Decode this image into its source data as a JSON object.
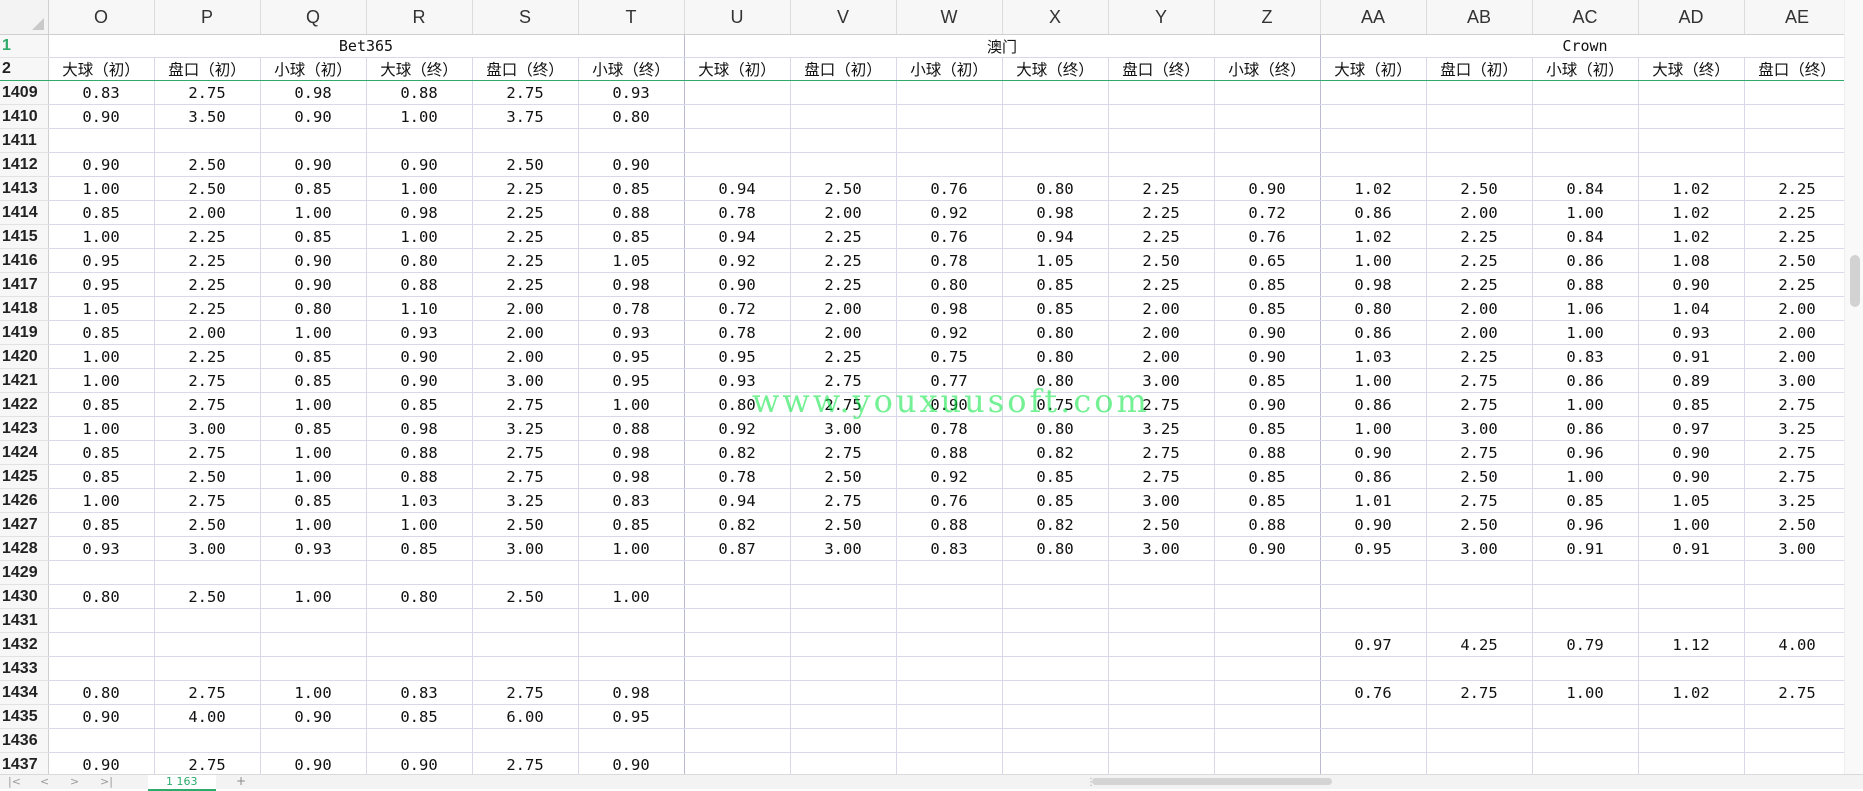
{
  "columns": [
    "O",
    "P",
    "Q",
    "R",
    "S",
    "T",
    "U",
    "V",
    "W",
    "X",
    "Y",
    "Z",
    "AA",
    "AB",
    "AC",
    "AD",
    "AE"
  ],
  "groups": [
    {
      "label": "Bet365",
      "span": 6
    },
    {
      "label": "澳门",
      "span": 6
    },
    {
      "label": "Crown",
      "span": 5
    }
  ],
  "subheaders": [
    "大球（初）",
    "盘口（初）",
    "小球（初）",
    "大球（终）",
    "盘口（终）",
    "小球（终）",
    "大球（初）",
    "盘口（初）",
    "小球（初）",
    "大球（终）",
    "盘口（终）",
    "小球（终）",
    "大球（初）",
    "盘口（初）",
    "小球（初）",
    "大球（终）",
    "盘口（终）"
  ],
  "header_rows": [
    "1",
    "2"
  ],
  "rows": [
    {
      "n": "1409",
      "v": [
        "0.83",
        "2.75",
        "0.98",
        "0.88",
        "2.75",
        "0.93",
        "",
        "",
        "",
        "",
        "",
        "",
        "",
        "",
        "",
        "",
        ""
      ]
    },
    {
      "n": "1410",
      "v": [
        "0.90",
        "3.50",
        "0.90",
        "1.00",
        "3.75",
        "0.80",
        "",
        "",
        "",
        "",
        "",
        "",
        "",
        "",
        "",
        "",
        ""
      ]
    },
    {
      "n": "1411",
      "v": [
        "",
        "",
        "",
        "",
        "",
        "",
        "",
        "",
        "",
        "",
        "",
        "",
        "",
        "",
        "",
        "",
        ""
      ]
    },
    {
      "n": "1412",
      "v": [
        "0.90",
        "2.50",
        "0.90",
        "0.90",
        "2.50",
        "0.90",
        "",
        "",
        "",
        "",
        "",
        "",
        "",
        "",
        "",
        "",
        ""
      ]
    },
    {
      "n": "1413",
      "v": [
        "1.00",
        "2.50",
        "0.85",
        "1.00",
        "2.25",
        "0.85",
        "0.94",
        "2.50",
        "0.76",
        "0.80",
        "2.25",
        "0.90",
        "1.02",
        "2.50",
        "0.84",
        "1.02",
        "2.25"
      ]
    },
    {
      "n": "1414",
      "v": [
        "0.85",
        "2.00",
        "1.00",
        "0.98",
        "2.25",
        "0.88",
        "0.78",
        "2.00",
        "0.92",
        "0.98",
        "2.25",
        "0.72",
        "0.86",
        "2.00",
        "1.00",
        "1.02",
        "2.25"
      ]
    },
    {
      "n": "1415",
      "v": [
        "1.00",
        "2.25",
        "0.85",
        "1.00",
        "2.25",
        "0.85",
        "0.94",
        "2.25",
        "0.76",
        "0.94",
        "2.25",
        "0.76",
        "1.02",
        "2.25",
        "0.84",
        "1.02",
        "2.25"
      ]
    },
    {
      "n": "1416",
      "v": [
        "0.95",
        "2.25",
        "0.90",
        "0.80",
        "2.25",
        "1.05",
        "0.92",
        "2.25",
        "0.78",
        "1.05",
        "2.50",
        "0.65",
        "1.00",
        "2.25",
        "0.86",
        "1.08",
        "2.50"
      ]
    },
    {
      "n": "1417",
      "v": [
        "0.95",
        "2.25",
        "0.90",
        "0.88",
        "2.25",
        "0.98",
        "0.90",
        "2.25",
        "0.80",
        "0.85",
        "2.25",
        "0.85",
        "0.98",
        "2.25",
        "0.88",
        "0.90",
        "2.25"
      ]
    },
    {
      "n": "1418",
      "v": [
        "1.05",
        "2.25",
        "0.80",
        "1.10",
        "2.00",
        "0.78",
        "0.72",
        "2.00",
        "0.98",
        "0.85",
        "2.00",
        "0.85",
        "0.80",
        "2.00",
        "1.06",
        "1.04",
        "2.00"
      ]
    },
    {
      "n": "1419",
      "v": [
        "0.85",
        "2.00",
        "1.00",
        "0.93",
        "2.00",
        "0.93",
        "0.78",
        "2.00",
        "0.92",
        "0.80",
        "2.00",
        "0.90",
        "0.86",
        "2.00",
        "1.00",
        "0.93",
        "2.00"
      ]
    },
    {
      "n": "1420",
      "v": [
        "1.00",
        "2.25",
        "0.85",
        "0.90",
        "2.00",
        "0.95",
        "0.95",
        "2.25",
        "0.75",
        "0.80",
        "2.00",
        "0.90",
        "1.03",
        "2.25",
        "0.83",
        "0.91",
        "2.00"
      ]
    },
    {
      "n": "1421",
      "v": [
        "1.00",
        "2.75",
        "0.85",
        "0.90",
        "3.00",
        "0.95",
        "0.93",
        "2.75",
        "0.77",
        "0.80",
        "3.00",
        "0.85",
        "1.00",
        "2.75",
        "0.86",
        "0.89",
        "3.00"
      ]
    },
    {
      "n": "1422",
      "v": [
        "0.85",
        "2.75",
        "1.00",
        "0.85",
        "2.75",
        "1.00",
        "0.80",
        "2.75",
        "0.90",
        "0.75",
        "2.75",
        "0.90",
        "0.86",
        "2.75",
        "1.00",
        "0.85",
        "2.75"
      ]
    },
    {
      "n": "1423",
      "v": [
        "1.00",
        "3.00",
        "0.85",
        "0.98",
        "3.25",
        "0.88",
        "0.92",
        "3.00",
        "0.78",
        "0.80",
        "3.25",
        "0.85",
        "1.00",
        "3.00",
        "0.86",
        "0.97",
        "3.25"
      ]
    },
    {
      "n": "1424",
      "v": [
        "0.85",
        "2.75",
        "1.00",
        "0.88",
        "2.75",
        "0.98",
        "0.82",
        "2.75",
        "0.88",
        "0.82",
        "2.75",
        "0.88",
        "0.90",
        "2.75",
        "0.96",
        "0.90",
        "2.75"
      ]
    },
    {
      "n": "1425",
      "v": [
        "0.85",
        "2.50",
        "1.00",
        "0.88",
        "2.75",
        "0.98",
        "0.78",
        "2.50",
        "0.92",
        "0.85",
        "2.75",
        "0.85",
        "0.86",
        "2.50",
        "1.00",
        "0.90",
        "2.75"
      ]
    },
    {
      "n": "1426",
      "v": [
        "1.00",
        "2.75",
        "0.85",
        "1.03",
        "3.25",
        "0.83",
        "0.94",
        "2.75",
        "0.76",
        "0.85",
        "3.00",
        "0.85",
        "1.01",
        "2.75",
        "0.85",
        "1.05",
        "3.25"
      ]
    },
    {
      "n": "1427",
      "v": [
        "0.85",
        "2.50",
        "1.00",
        "1.00",
        "2.50",
        "0.85",
        "0.82",
        "2.50",
        "0.88",
        "0.82",
        "2.50",
        "0.88",
        "0.90",
        "2.50",
        "0.96",
        "1.00",
        "2.50"
      ]
    },
    {
      "n": "1428",
      "v": [
        "0.93",
        "3.00",
        "0.93",
        "0.85",
        "3.00",
        "1.00",
        "0.87",
        "3.00",
        "0.83",
        "0.80",
        "3.00",
        "0.90",
        "0.95",
        "3.00",
        "0.91",
        "0.91",
        "3.00"
      ]
    },
    {
      "n": "1429",
      "v": [
        "",
        "",
        "",
        "",
        "",
        "",
        "",
        "",
        "",
        "",
        "",
        "",
        "",
        "",
        "",
        "",
        ""
      ]
    },
    {
      "n": "1430",
      "v": [
        "0.80",
        "2.50",
        "1.00",
        "0.80",
        "2.50",
        "1.00",
        "",
        "",
        "",
        "",
        "",
        "",
        "",
        "",
        "",
        "",
        ""
      ]
    },
    {
      "n": "1431",
      "v": [
        "",
        "",
        "",
        "",
        "",
        "",
        "",
        "",
        "",
        "",
        "",
        "",
        "",
        "",
        "",
        "",
        ""
      ]
    },
    {
      "n": "1432",
      "v": [
        "",
        "",
        "",
        "",
        "",
        "",
        "",
        "",
        "",
        "",
        "",
        "",
        "0.97",
        "4.25",
        "0.79",
        "1.12",
        "4.00"
      ]
    },
    {
      "n": "1433",
      "v": [
        "",
        "",
        "",
        "",
        "",
        "",
        "",
        "",
        "",
        "",
        "",
        "",
        "",
        "",
        "",
        "",
        ""
      ]
    },
    {
      "n": "1434",
      "v": [
        "0.80",
        "2.75",
        "1.00",
        "0.83",
        "2.75",
        "0.98",
        "",
        "",
        "",
        "",
        "",
        "",
        "0.76",
        "2.75",
        "1.00",
        "1.02",
        "2.75"
      ]
    },
    {
      "n": "1435",
      "v": [
        "0.90",
        "4.00",
        "0.90",
        "0.85",
        "6.00",
        "0.95",
        "",
        "",
        "",
        "",
        "",
        "",
        "",
        "",
        "",
        "",
        ""
      ]
    },
    {
      "n": "1436",
      "v": [
        "",
        "",
        "",
        "",
        "",
        "",
        "",
        "",
        "",
        "",
        "",
        "",
        "",
        "",
        "",
        "",
        ""
      ]
    },
    {
      "n": "1437",
      "v": [
        "0.90",
        "2.75",
        "0.90",
        "0.90",
        "2.75",
        "0.90",
        "",
        "",
        "",
        "",
        "",
        "",
        "",
        "",
        "",
        "",
        ""
      ]
    }
  ],
  "watermark": "www.youxuusoft.com",
  "sheet_tab": "1 163",
  "nav": {
    "first": "|<",
    "prev": "<",
    "next": ">",
    "last": ">|",
    "add": "+"
  }
}
